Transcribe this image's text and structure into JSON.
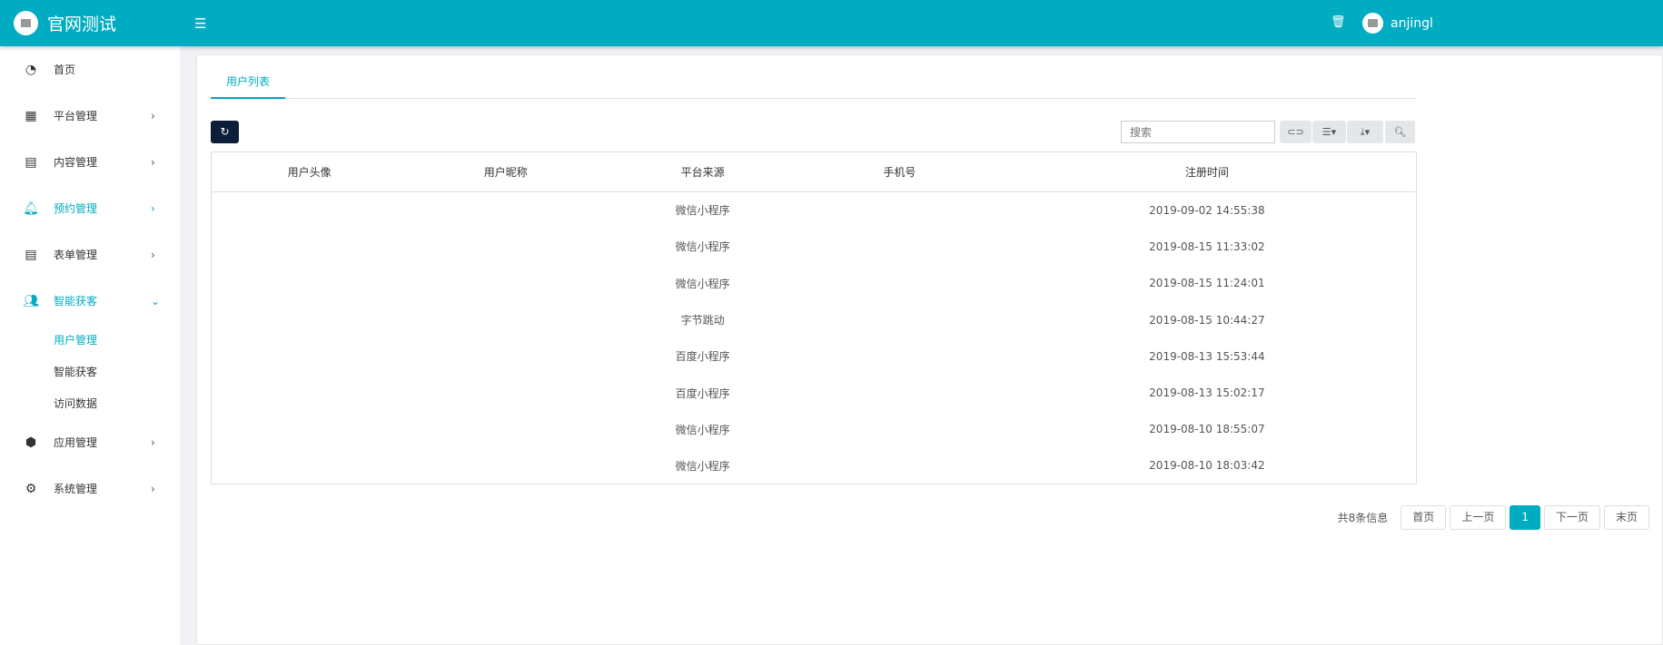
{
  "app": {
    "title": "官网测试",
    "user": "anjingl"
  },
  "sidebar": {
    "items": [
      {
        "label": "首页",
        "icon": "dashboard-icon"
      },
      {
        "label": "平台管理",
        "icon": "grid-icon"
      },
      {
        "label": "内容管理",
        "icon": "file-icon"
      },
      {
        "label": "预约管理",
        "icon": "bell-icon"
      },
      {
        "label": "表单管理",
        "icon": "file-icon"
      },
      {
        "label": "智能获客",
        "icon": "users-icon"
      },
      {
        "label": "应用管理",
        "icon": "cube-icon"
      },
      {
        "label": "系统管理",
        "icon": "gear-icon"
      }
    ],
    "sub": [
      "用户管理",
      "智能获客",
      "访问数据"
    ]
  },
  "tab": "用户列表",
  "search": {
    "placeholder": "搜索"
  },
  "table": {
    "headers": [
      "用户头像",
      "用户昵称",
      "平台来源",
      "手机号",
      "注册时间"
    ],
    "rows": [
      [
        "",
        "",
        "微信小程序",
        "",
        "2019-09-02 14:55:38"
      ],
      [
        "",
        "",
        "微信小程序",
        "",
        "2019-08-15 11:33:02"
      ],
      [
        "",
        "",
        "微信小程序",
        "",
        "2019-08-15 11:24:01"
      ],
      [
        "",
        "",
        "字节跳动",
        "",
        "2019-08-15 10:44:27"
      ],
      [
        "",
        "",
        "百度小程序",
        "",
        "2019-08-13 15:53:44"
      ],
      [
        "",
        "",
        "百度小程序",
        "",
        "2019-08-13 15:02:17"
      ],
      [
        "",
        "",
        "微信小程序",
        "",
        "2019-08-10 18:55:07"
      ],
      [
        "",
        "",
        "微信小程序",
        "",
        "2019-08-10 18:03:42"
      ]
    ]
  },
  "pager": {
    "info": "共8条信息",
    "first": "首页",
    "prev": "上一页",
    "current": "1",
    "next": "下一页",
    "last": "末页"
  }
}
